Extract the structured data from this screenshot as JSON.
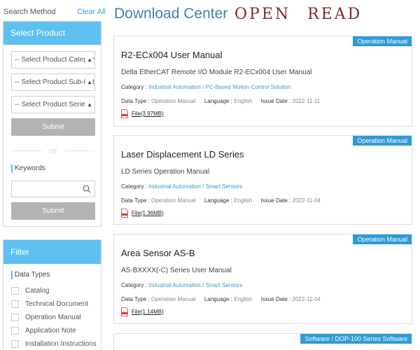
{
  "sidebar": {
    "search_method": "Search Method",
    "clear_all": "Clear All",
    "select_product": {
      "title": "Select Product",
      "category_select": "-- Select Product Category",
      "subcategory_select": "-- Select Product Sub-Category",
      "series_select": "-- Select Product Series",
      "submit": "Submit"
    },
    "or_text": "or",
    "keywords_label": "Keywords",
    "keywords_value": "",
    "keywords_submit": "Submit",
    "filter": {
      "title": "Filter",
      "data_types_label": "Data Types",
      "options": [
        "Catalog",
        "Technical Document",
        "Operation Manual",
        "Application Note",
        "Installation Instructions"
      ]
    }
  },
  "main": {
    "title": "Download Center",
    "banner": "OPEN READ",
    "labels": {
      "category": "Category :",
      "data_type": "Data Type :",
      "language": "Language :",
      "issue_date": "Issue Date :"
    },
    "cards": [
      {
        "tag": "Operation Manual",
        "title": "R2-ECx004 User Manual",
        "subtitle": "Delta EtherCAT Remote I/O Module R2-ECx004 User Manual",
        "category": "Industrial Automation / PC-Based Motion Control Solution",
        "data_type": "Operation Manual",
        "language": "English",
        "issue_date": "2022-11-11",
        "file": "File(3.97MB)"
      },
      {
        "tag": "Operation Manual",
        "title": "Laser Displacement LD Series",
        "subtitle": "LD Series Operation Manual",
        "category": "Industrial Automation / Smart Sensors",
        "data_type": "Operation Manual",
        "language": "English",
        "issue_date": "2022-11-04",
        "file": "File(1.36MB)"
      },
      {
        "tag": "Operation Manual",
        "title": "Area Sensor AS-B",
        "subtitle": "AS-BXXXX(-C) Series User Manual",
        "category": "Industrial Automation / Smart Sensors",
        "data_type": "Operation Manual",
        "language": "English",
        "issue_date": "2022-11-04",
        "file": "File(1.14MB)"
      },
      {
        "tag": "Software / DOP-100 Series Software"
      }
    ]
  },
  "colors": {
    "panel_header": "#5ec0f0",
    "tag": "#2f9ad6",
    "title": "#3c81b5",
    "banner": "#7a2b2b",
    "link": "#3c97cf",
    "button": "#b3b3b3"
  }
}
